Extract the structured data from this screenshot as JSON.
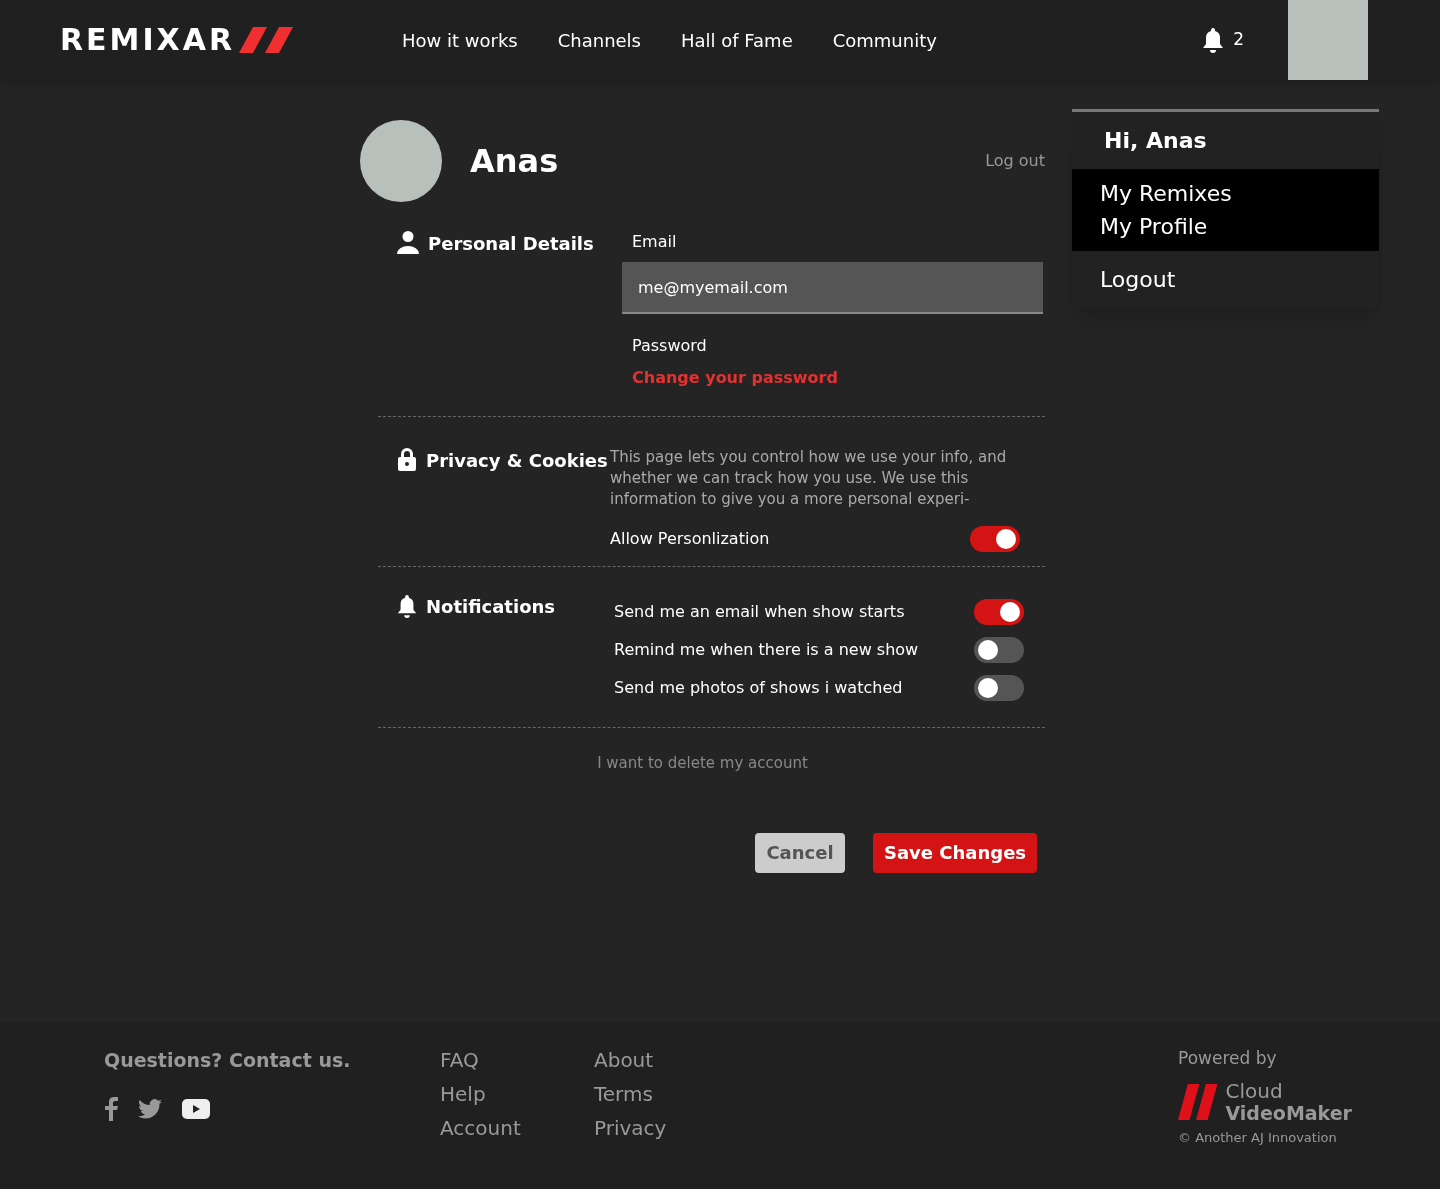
{
  "header": {
    "logo": "REMIXAR",
    "nav": [
      "How it works",
      "Channels",
      "Hall of Fame",
      "Community"
    ],
    "notification_count": "2"
  },
  "user_menu": {
    "greeting": "Hi, Anas",
    "items": [
      "My Remixes",
      "My Profile"
    ],
    "logout": "Logout"
  },
  "profile": {
    "name": "Anas",
    "logout": "Log out"
  },
  "personal_details": {
    "heading": "Personal Details",
    "email_label": "Email",
    "email_value": "me@myemail.com",
    "password_label": "Password",
    "change_password": "Change your password"
  },
  "privacy": {
    "heading": "Privacy & Cookies",
    "description": "This page lets you control how we use your info, and whether we can track how you use. We use this information to give you a more personal experi-",
    "toggles": [
      {
        "label": "Allow Personlization",
        "on": true
      }
    ]
  },
  "notifications": {
    "heading": "Notifications",
    "toggles": [
      {
        "label": "Send me an email when show starts",
        "on": true
      },
      {
        "label": "Remind me when there is a new show",
        "on": false
      },
      {
        "label": "Send me photos of shows i watched",
        "on": false
      }
    ]
  },
  "delete_account": "I want to delete my account",
  "buttons": {
    "cancel": "Cancel",
    "save": "Save Changes"
  },
  "footer": {
    "contact": "Questions? Contact us.",
    "links_col1": [
      "FAQ",
      "Help",
      "Account"
    ],
    "links_col2": [
      "About",
      "Terms",
      "Privacy"
    ],
    "powered_by": "Powered by",
    "brand_line1": "Cloud",
    "brand_line2": "VideoMaker",
    "copyright": "© Another AJ Innovation"
  }
}
